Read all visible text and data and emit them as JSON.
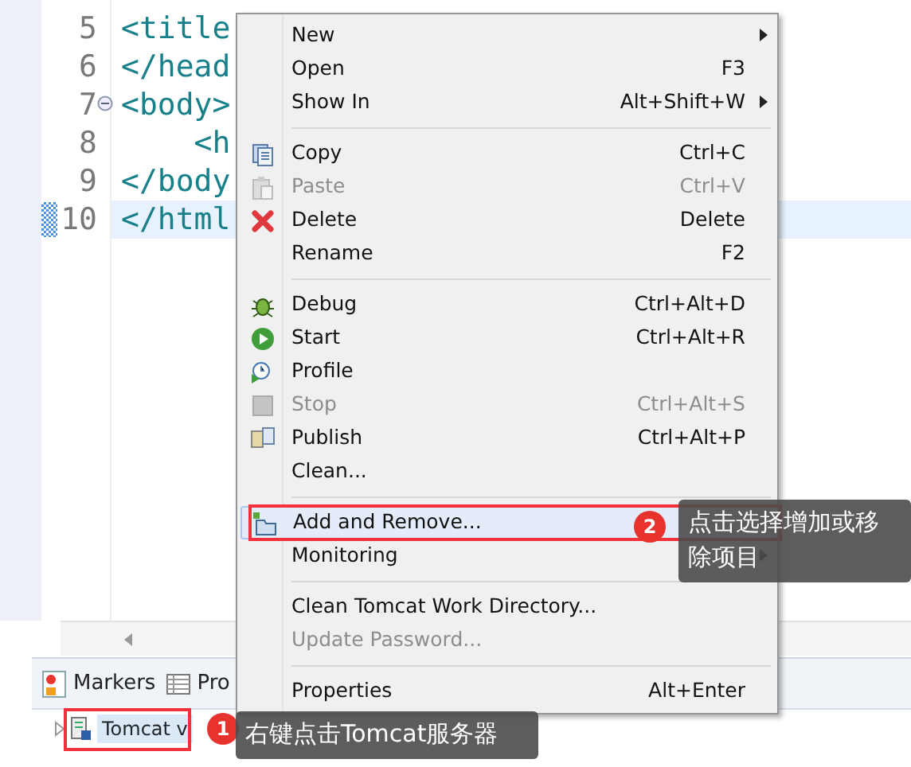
{
  "editor": {
    "lines": [
      {
        "number": "5",
        "text": "<title",
        "foldable": false,
        "current": false
      },
      {
        "number": "6",
        "text": "</head",
        "foldable": false,
        "current": false
      },
      {
        "number": "7",
        "text": "<body>",
        "foldable": true,
        "current": false
      },
      {
        "number": "8",
        "text": "    <h",
        "foldable": false,
        "current": false
      },
      {
        "number": "9",
        "text": "</body",
        "foldable": false,
        "current": false
      },
      {
        "number": "10",
        "text": "</html",
        "foldable": false,
        "current": true
      }
    ]
  },
  "context_menu": {
    "items": [
      {
        "kind": "item",
        "label": "New",
        "submenu": true,
        "disabled": false,
        "selected": false
      },
      {
        "kind": "item",
        "label": "Open",
        "shortcut": "F3",
        "submenu": false,
        "disabled": false,
        "selected": false
      },
      {
        "kind": "item",
        "label": "Show In",
        "shortcut": "Alt+Shift+W",
        "submenu": true,
        "disabled": false,
        "selected": false
      },
      {
        "kind": "separator"
      },
      {
        "kind": "item",
        "label": "Copy",
        "shortcut": "Ctrl+C",
        "submenu": false,
        "disabled": false,
        "selected": false
      },
      {
        "kind": "item",
        "label": "Paste",
        "shortcut": "Ctrl+V",
        "submenu": false,
        "disabled": true,
        "selected": false
      },
      {
        "kind": "item",
        "label": "Delete",
        "shortcut": "Delete",
        "submenu": false,
        "disabled": false,
        "selected": false
      },
      {
        "kind": "item",
        "label": "Rename",
        "shortcut": "F2",
        "submenu": false,
        "disabled": false,
        "selected": false
      },
      {
        "kind": "separator"
      },
      {
        "kind": "item",
        "label": "Debug",
        "shortcut": "Ctrl+Alt+D",
        "submenu": false,
        "disabled": false,
        "selected": false
      },
      {
        "kind": "item",
        "label": "Start",
        "shortcut": "Ctrl+Alt+R",
        "submenu": false,
        "disabled": false,
        "selected": false
      },
      {
        "kind": "item",
        "label": "Profile",
        "submenu": false,
        "disabled": false,
        "selected": false
      },
      {
        "kind": "item",
        "label": "Stop",
        "shortcut": "Ctrl+Alt+S",
        "submenu": false,
        "disabled": true,
        "selected": false
      },
      {
        "kind": "item",
        "label": "Publish",
        "shortcut": "Ctrl+Alt+P",
        "submenu": false,
        "disabled": false,
        "selected": false
      },
      {
        "kind": "item",
        "label": "Clean...",
        "submenu": false,
        "disabled": false,
        "selected": false
      },
      {
        "kind": "separator"
      },
      {
        "kind": "item",
        "label": "Add and Remove...",
        "submenu": false,
        "disabled": false,
        "selected": true
      },
      {
        "kind": "item",
        "label": "Monitoring",
        "submenu": true,
        "disabled": false,
        "selected": false
      },
      {
        "kind": "separator"
      },
      {
        "kind": "item",
        "label": "Clean Tomcat Work Directory...",
        "submenu": false,
        "disabled": false,
        "selected": false
      },
      {
        "kind": "item",
        "label": "Update Password...",
        "submenu": false,
        "disabled": true,
        "selected": false
      },
      {
        "kind": "separator"
      },
      {
        "kind": "item",
        "label": "Properties",
        "shortcut": "Alt+Enter",
        "submenu": false,
        "disabled": false,
        "selected": false
      }
    ]
  },
  "bottom_panel": {
    "tabs": [
      {
        "label": "Markers"
      },
      {
        "label": "Pro"
      }
    ],
    "tree_row": {
      "label": "Tomcat v",
      "selected": true
    }
  },
  "callouts": [
    {
      "number": "1",
      "text": "右键点击Tomcat服务器"
    },
    {
      "number": "2",
      "text": "点击选择增加或移除项目"
    }
  ]
}
